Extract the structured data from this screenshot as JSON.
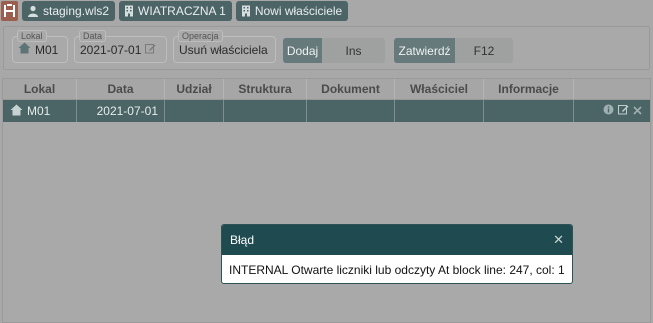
{
  "breadcrumb": {
    "items": [
      {
        "label": "staging.wls2",
        "icon": "user-icon"
      },
      {
        "label": "WIATRACZNA 1",
        "icon": "building-icon"
      },
      {
        "label": "Nowi właściciele",
        "icon": "building-icon"
      }
    ]
  },
  "filters": {
    "lokal": {
      "legend": "Lokal",
      "value": "M01"
    },
    "data": {
      "legend": "Data",
      "value": "2021-07-01"
    },
    "operacja": {
      "legend": "Operacja",
      "value": "Usuń właściciela"
    },
    "add_button": {
      "label": "Dodaj",
      "shortcut": "Ins"
    },
    "confirm_button": {
      "label": "Zatwierdź",
      "shortcut": "F12"
    }
  },
  "table": {
    "columns": [
      "Lokal",
      "Data",
      "Udział",
      "Struktura",
      "Dokument",
      "Właściciel",
      "Informacje"
    ],
    "rows": [
      {
        "lokal": "M01",
        "data": "2021-07-01",
        "udzial": "",
        "struktura": "",
        "dokument": "",
        "wlasciciel": "",
        "informacje": ""
      }
    ]
  },
  "dialog": {
    "title": "Błąd",
    "message": "INTERNAL Otwarte liczniki lub odczyty At block line: 247, col: 1"
  },
  "colors": {
    "header_bg": "#1f4a4f",
    "row_selected": "#4b6466",
    "crumb_bg": "#4d6467"
  }
}
